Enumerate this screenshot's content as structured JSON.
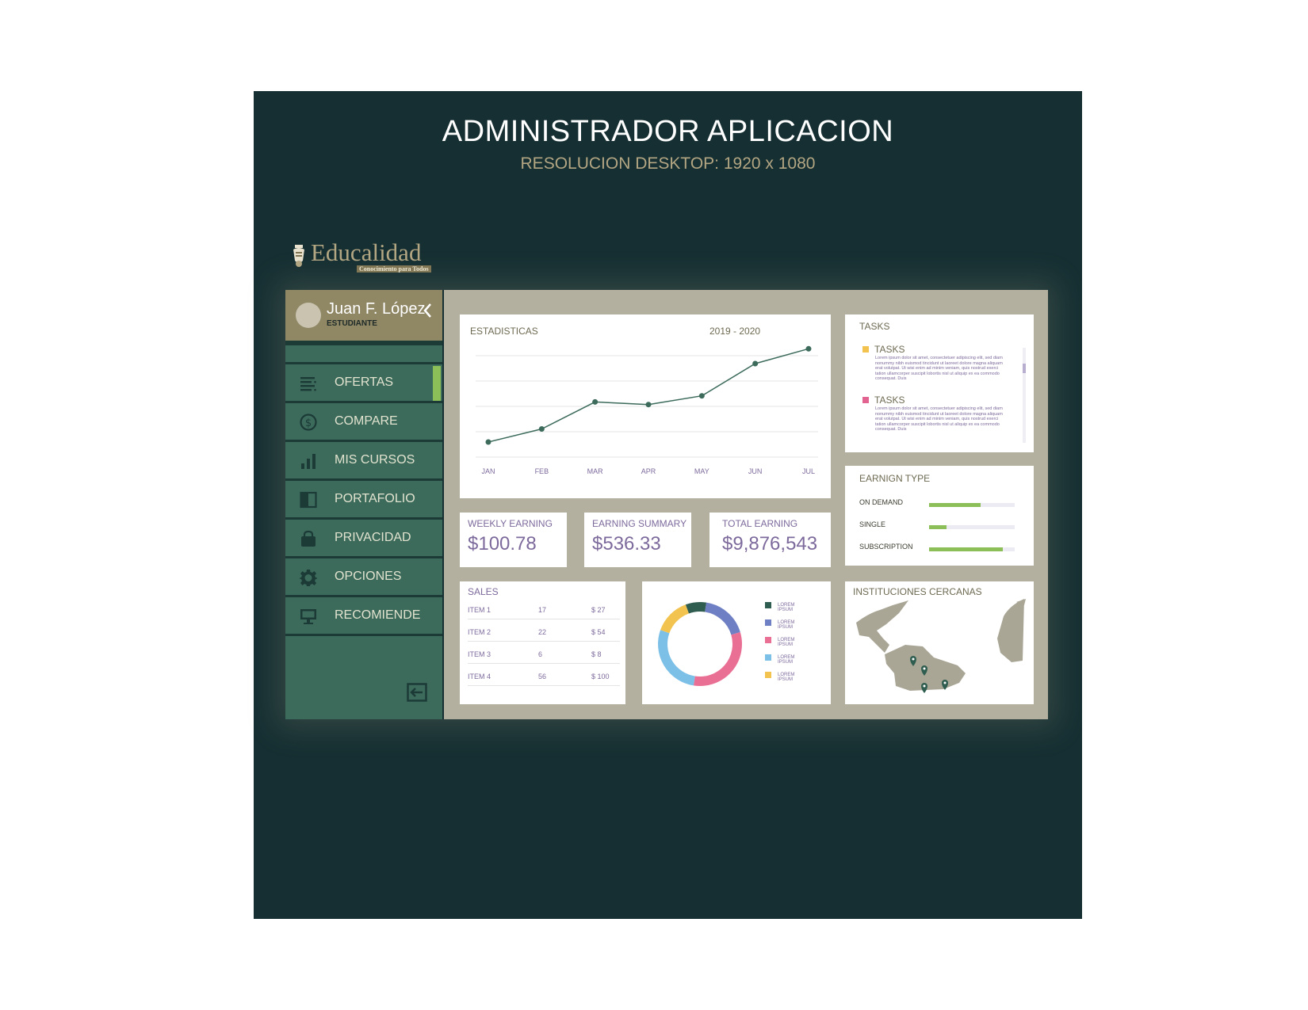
{
  "poster": {
    "title": "ADMINISTRADOR APLICACION",
    "subtitle": "RESOLUCION DESKTOP: 1920 x 1080"
  },
  "logo": {
    "name": "Educalidad",
    "tagline": "Conocimiento para Todos"
  },
  "profile": {
    "name": "Juan F. López",
    "role": "ESTUDIANTE"
  },
  "nav": [
    {
      "label": "OFERTAS",
      "icon": "list-icon",
      "active": true
    },
    {
      "label": "COMPARE",
      "icon": "dollar-icon",
      "active": false
    },
    {
      "label": "MIS CURSOS",
      "icon": "bar-chart-icon",
      "active": false
    },
    {
      "label": "PORTAFOLIO",
      "icon": "portfolio-icon",
      "active": false
    },
    {
      "label": "PRIVACIDAD",
      "icon": "lock-icon",
      "active": false
    },
    {
      "label": "OPCIONES",
      "icon": "gear-icon",
      "active": false
    },
    {
      "label": "RECOMIENDE",
      "icon": "monitor-icon",
      "active": false
    }
  ],
  "colors": {
    "poster_bg": "#162f32",
    "sidebar": "#3c6b5c",
    "profile_bg": "#908765",
    "accent_green": "#8dbf58",
    "main_bg": "#b3b0a0",
    "text_purple": "#7d6a9c"
  },
  "stats_card": {
    "title": "ESTADISTICAS",
    "period": "2019 - 2020"
  },
  "chart_data": {
    "type": "line",
    "categories": [
      "JAN",
      "FEB",
      "MAR",
      "APR",
      "MAY",
      "JUN",
      "JUL"
    ],
    "series": [
      {
        "values": [
          10,
          25,
          56,
          53,
          63,
          100,
          117
        ]
      }
    ],
    "ylim": [
      0,
      120
    ],
    "grid": true,
    "color": "#3c6b5c"
  },
  "tasks": {
    "title": "TASKS",
    "items": [
      {
        "label": "TASKS",
        "color": "#f2c44f",
        "text": "Lorem ipsum dolor sit amet, consectetuer adipiscing elit, sed diam nonummy nibh euismod tincidunt ut laoreet dolore magna aliquam erat volutpat. Ut wisi enim ad minim veniam, quis nostrud exerci tation ullamcorper suscipit lobortis nisl ut aliquip ex ea commodo consequat. Duis"
      },
      {
        "label": "TASKS",
        "color": "#e2638f",
        "text": "Lorem ipsum dolor sit amet, consectetuer adipiscing elit, sed diam nonummy nibh euismod tincidunt ut laoreet dolore magna aliquam erat volutpat. Ut wisi enim ad minim veniam, quis nostrud exerci tation ullamcorper suscipit lobortis nisl ut aliquip ex ea commodo consequat. Duis"
      }
    ]
  },
  "earning_type": {
    "title": "EARNIGN TYPE",
    "rows": [
      {
        "label": "ON DEMAND",
        "fraction": 0.6
      },
      {
        "label": "SINGLE",
        "fraction": 0.2
      },
      {
        "label": "SUBSCRIPTION",
        "fraction": 0.86
      }
    ]
  },
  "weekly": {
    "label": "WEEKLY EARNING",
    "value": "$100.78"
  },
  "summary": {
    "label": "EARNING SUMMARY",
    "value": "$536.33"
  },
  "total": {
    "label": "TOTAL EARNING",
    "value": "$9,876,543"
  },
  "sales": {
    "title": "SALES",
    "rows": [
      {
        "item": "ITEM 1",
        "qty": "17",
        "price": "$ 27"
      },
      {
        "item": "ITEM 2",
        "qty": "22",
        "price": "$ 54"
      },
      {
        "item": "ITEM 3",
        "qty": "6",
        "price": "$ 8"
      },
      {
        "item": "ITEM 4",
        "qty": "56",
        "price": "$ 100"
      }
    ]
  },
  "donut": {
    "slices": [
      {
        "label": "LOREM IPSUM",
        "color": "#2f5d4f",
        "value": 8
      },
      {
        "label": "LOREM IPSUM",
        "color": "#6f7fc4",
        "value": 18
      },
      {
        "label": "LOREM IPSUM",
        "color": "#ea6f95",
        "value": 32
      },
      {
        "label": "LOREM IPSUM",
        "color": "#7cc0e8",
        "value": 28
      },
      {
        "label": "LOREM IPSUM",
        "color": "#f2c44f",
        "value": 14
      }
    ]
  },
  "map": {
    "title": "INSTITUCIONES CERCANAS"
  }
}
